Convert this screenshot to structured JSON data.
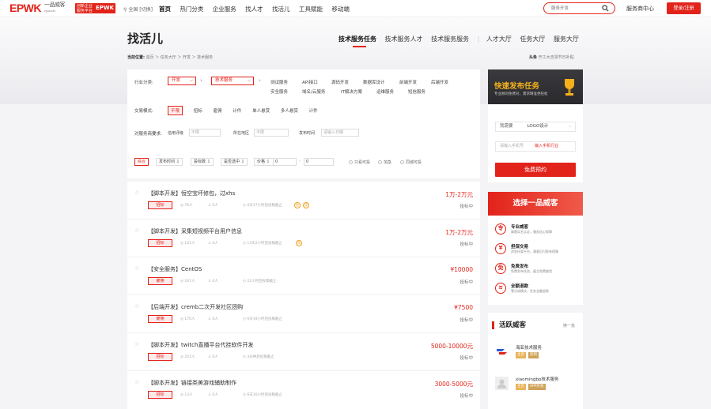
{
  "header": {
    "logo": "EPWK",
    "logo_cn": "一品威客",
    "logo_url": "epwk.com",
    "badge": {
      "top": "创新企业服务平台",
      "brand": "EPWK"
    },
    "location": "全国 [切换]",
    "nav": [
      "首页",
      "热门分类",
      "企业服务",
      "找人才",
      "找活儿",
      "工具赋能",
      "移动端"
    ],
    "search_placeholder": "服务开发",
    "service_center": "服务商中心",
    "login_label": "登录/注册"
  },
  "page": {
    "title": "找活儿",
    "tabs": [
      "技术服务任务",
      "技术服务人才",
      "技术服务服务",
      "人才大厅",
      "任务大厅",
      "服务大厅"
    ],
    "breadcrumb_label": "当前位置:",
    "breadcrumb": "首页 ＞ 任务大厅 ＞ 开发 ＞ 技术服务",
    "headline_label": "头条",
    "headline": "开工大吉领节日补贴"
  },
  "filters": {
    "industry_label": "行业分类:",
    "industry_value": "开发",
    "sub_value": "技术服务",
    "tags_row1": [
      "测试服务",
      "API接口",
      "源码开发",
      "数据库设计",
      "前端开发",
      "后端开发"
    ],
    "tags_row2": [
      "安全服务",
      "域名/云服务",
      "IT解决方案",
      "运维服务",
      "短信服务"
    ],
    "mode_label": "交易模式:",
    "modes": [
      "不限",
      "招标",
      "雇佣",
      "计件",
      "单人悬赏",
      "多人悬赏",
      "计件"
    ],
    "sp_label": "对服务商要求:",
    "sp_credit_label": "信用评级",
    "sp_credit_value": "不限",
    "sp_area_label": "所在地区",
    "sp_area_value": "不限",
    "sp_time_label": "发布时间",
    "sp_time_value": "请输入日期",
    "sort": [
      "综合",
      "发布时间 ⇩",
      "投标数 ⇩",
      "是否选中 ⇩",
      "价格 ⇩"
    ],
    "price_from": "0",
    "price_to": "0",
    "checks": [
      "只看可投",
      "加急",
      "同城可投"
    ]
  },
  "tasks": [
    {
      "title": "【脚本开发】恒空宝坏修包，过xhs",
      "status": "招标",
      "views": "76人",
      "bids": "0人",
      "time": "0天17小时后投稿截止",
      "price": "1万-2万元",
      "state": "投标中"
    },
    {
      "title": "【脚本开发】采集短视频平台用户信息",
      "status": "招标",
      "views": "101人",
      "bids": "0人",
      "time": "13天2小时后投稿截止",
      "price": "1万-2万元",
      "state": "投标中"
    },
    {
      "title": "【安全服务】CentOS",
      "status": "雇佣",
      "views": "247人",
      "bids": "0人",
      "time": "22小时后投稿截止",
      "price": "¥10000",
      "state": "投标中"
    },
    {
      "title": "【后端开发】cremb二次开发社区团购",
      "status": "雇佣",
      "views": "170人",
      "bids": "0人",
      "time": "6天19小时后投稿截止",
      "price": "¥7500",
      "state": "投标中"
    },
    {
      "title": "【脚本开发】twitch直播平台代挂软件开发",
      "status": "招标",
      "views": "251人",
      "bids": "0人",
      "time": "3分钟后投稿截止",
      "price": "5000-10000元",
      "state": "投标中"
    },
    {
      "title": "【脚本开发】链接类美游戏辅助制作",
      "status": "招标",
      "views": "13人",
      "bids": "0人",
      "time": "6天16小时后投稿截止",
      "price": "3000-5000元",
      "state": "投标中"
    }
  ],
  "quick_publish": {
    "title": "快速发布任务",
    "subtitle": "专业顾问免费对，需求精准更轻松",
    "category_label": "我需要",
    "category_value": "LOGO设计",
    "phone_placeholder": "请输入手机号",
    "code_label": "输入手机行业",
    "button": "免费预约"
  },
  "why": {
    "title": "选择一品威客",
    "items": [
      {
        "icon": "专",
        "title": "专业威客",
        "desc": "威客实名认证，服务信心保障"
      },
      {
        "icon": "¥",
        "title": "担保交易",
        "desc": "资金托管平台，满意后付款有保障"
      },
      {
        "icon": "免",
        "title": "免费发布",
        "desc": "免费发布任务，雇主免费使用"
      },
      {
        "icon": "≋",
        "title": "全额退款",
        "desc": "零分成模式，任务全额退款"
      }
    ]
  },
  "active": {
    "title": "活跃威客",
    "more": "换一批",
    "items": [
      {
        "name": "海亚技术服务",
        "b1": "主页",
        "b2": "案例"
      },
      {
        "name": "xiaomingbp技术服务",
        "b1": "主页",
        "b2": "APP开发"
      }
    ]
  },
  "colors": {
    "brand": "#e2231a",
    "gold": "#f5b11b",
    "bg": "#f4f4f6"
  }
}
